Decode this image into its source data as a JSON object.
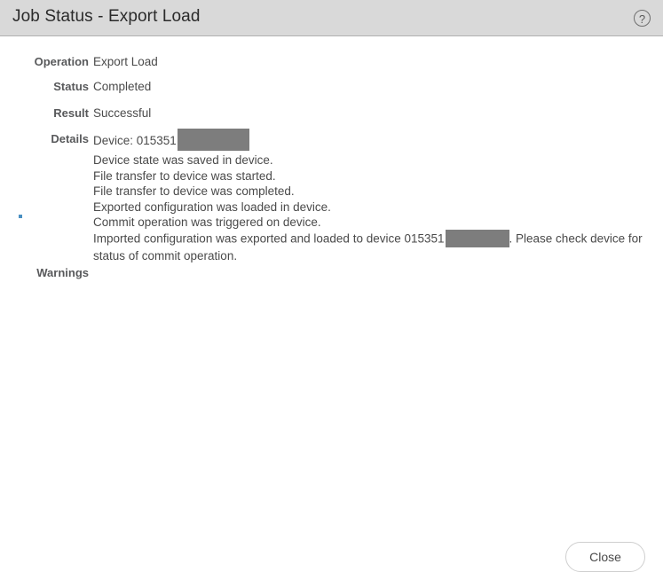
{
  "header": {
    "title": "Job Status - Export Load",
    "help_icon": "help-circle-icon",
    "help_glyph": "?",
    "background_color": "#d9d9d9"
  },
  "fields": {
    "operation": {
      "label": "Operation",
      "value": "Export Load"
    },
    "status": {
      "label": "Status",
      "value": "Completed"
    },
    "result": {
      "label": "Result",
      "value": "Successful"
    },
    "details": {
      "label": "Details"
    },
    "warnings": {
      "label": "Warnings",
      "value": ""
    }
  },
  "details": {
    "device_prefix": "Device: 015351",
    "lines": [
      "Device state was saved in device.",
      "File transfer to device was started.",
      "File transfer to device was completed.",
      "Exported configuration was loaded in device.",
      "Commit operation was triggered on device."
    ],
    "summary_prefix": "Imported configuration was exported and loaded to device 015351",
    "summary_suffix": ". Please check device for status of commit operation."
  },
  "footer": {
    "close_label": "Close"
  },
  "colors": {
    "label": "#58595b",
    "value": "#4a4a4a",
    "redaction": "#7d7d7d",
    "bullet": "#4a90c2",
    "header_border": "#b0b0b0"
  }
}
